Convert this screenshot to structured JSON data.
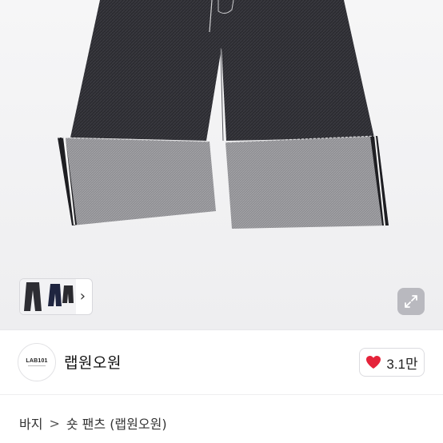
{
  "product": {
    "image_alt": "wide cuffed denim shorts"
  },
  "thumbnails": {
    "arrow_icon": "chevron-right-icon"
  },
  "expand": {
    "icon": "expand-icon"
  },
  "shop": {
    "avatar_text": "LAB101",
    "name": "랩원오원"
  },
  "like": {
    "icon": "heart-icon",
    "count": "3.1만",
    "color": "#e5233a"
  },
  "breadcrumb": {
    "items": [
      "바지",
      "숏 팬츠 (랩원오원)"
    ],
    "separator": ">"
  }
}
